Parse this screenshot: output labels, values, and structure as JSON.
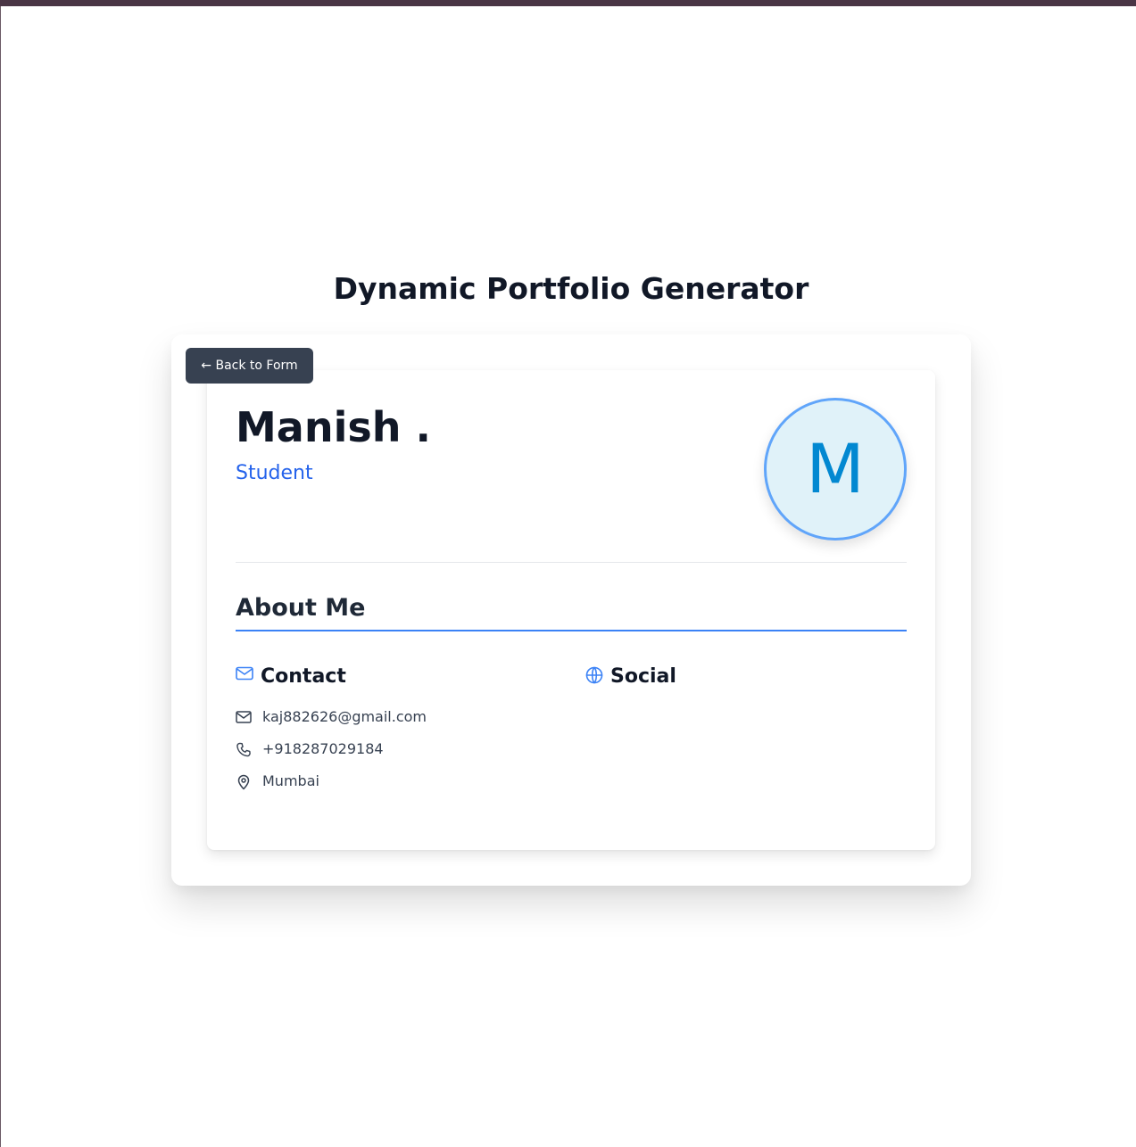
{
  "header": {
    "title": "Dynamic Portfolio Generator"
  },
  "toolbar": {
    "back_label": "← Back to Form"
  },
  "profile": {
    "name": "Manish .",
    "role": "Student",
    "avatar_initial": "M"
  },
  "about": {
    "title": "About Me"
  },
  "contact": {
    "title": "Contact",
    "icon": "mail-icon",
    "email": "kaj882626@gmail.com",
    "phone": "+918287029184",
    "location": "Mumbai"
  },
  "social": {
    "title": "Social",
    "icon": "globe-icon"
  },
  "colors": {
    "accent": "#2563eb",
    "icon_accent": "#3b82f6",
    "avatar_bg": "#e0f2f9",
    "avatar_border": "#60a5fa",
    "avatar_text": "#0288d1",
    "button_bg": "#374151"
  }
}
